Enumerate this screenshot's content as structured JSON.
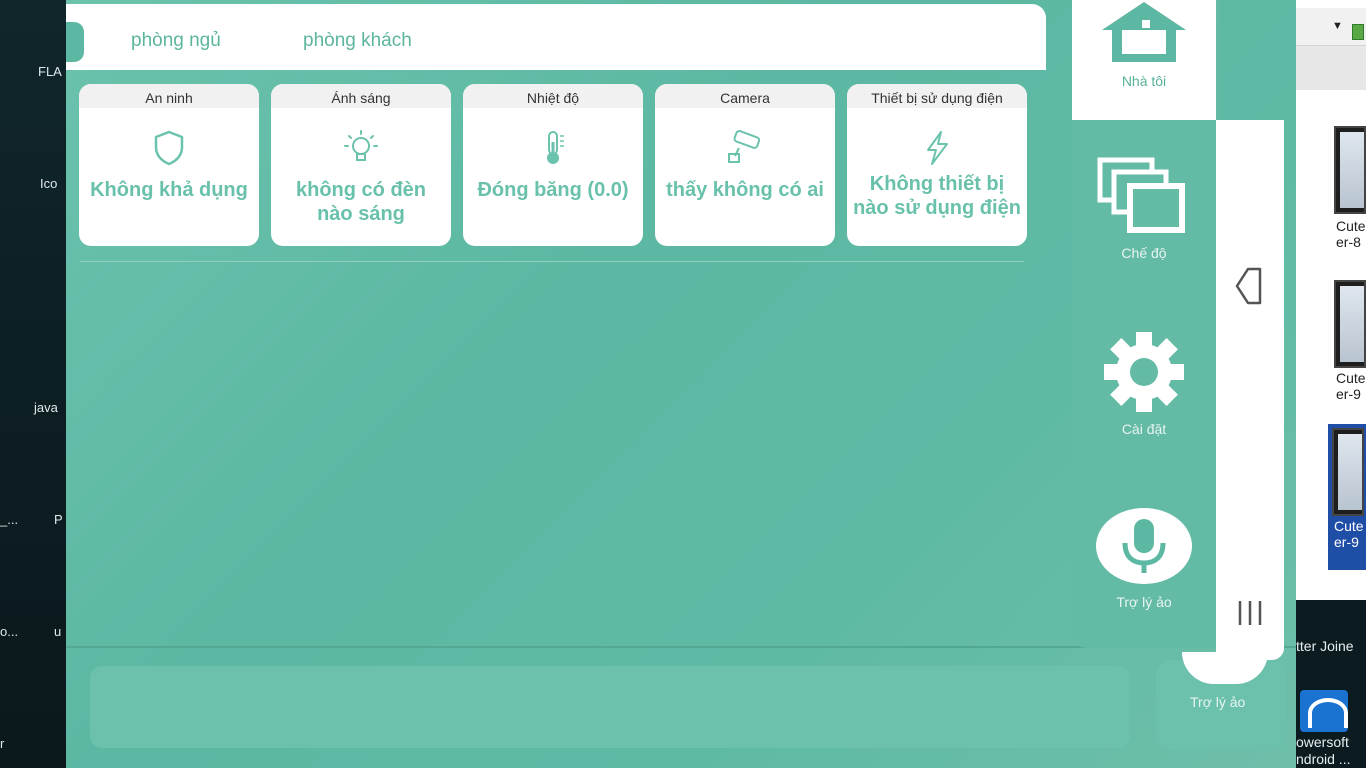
{
  "desktop": {
    "left_icons": [
      "FLA",
      "Ico",
      "java",
      "_...",
      "P",
      "o...",
      "u",
      "r"
    ],
    "explorer_thumbnails": [
      {
        "label_line1": "Cute",
        "label_line2": "er-8"
      },
      {
        "label_line1": "Cute",
        "label_line2": "er-9"
      },
      {
        "label_line1": "Cute",
        "label_line2": "er-9"
      }
    ],
    "taskbar_texts": [
      "tter Joine",
      "owersoft",
      "ndroid ..."
    ]
  },
  "tabs": [
    {
      "label": "phòng ngủ"
    },
    {
      "label": "phòng khách"
    }
  ],
  "cards": [
    {
      "title": "An ninh",
      "icon": "shield-icon",
      "status": "Không khả dụng"
    },
    {
      "title": "Ánh sáng",
      "icon": "lightbulb-icon",
      "status": "không có đèn nào sáng"
    },
    {
      "title": "Nhiệt độ",
      "icon": "thermometer-icon",
      "status": "Đóng băng (0.0)"
    },
    {
      "title": "Camera",
      "icon": "security-camera-icon",
      "status": "thấy không có ai"
    },
    {
      "title": "Thiết bị sử dụng điện",
      "icon": "lightning-icon",
      "status": "Không thiết bị nào sử dụng điện"
    }
  ],
  "sidebar": {
    "items": [
      {
        "label": "Nhà tôi",
        "icon": "home-icon",
        "active": true
      },
      {
        "label": "Chế độ",
        "icon": "layers-icon",
        "active": false
      },
      {
        "label": "Cài đặt",
        "icon": "gear-icon",
        "active": false
      },
      {
        "label": "Trợ lý ảo",
        "icon": "microphone-icon",
        "active": false
      }
    ]
  },
  "lower_ghost_label": "Trợ lý ảo",
  "colors": {
    "accent": "#5cb8a2",
    "accent_text": "#69c1ac",
    "card_bg": "#ffffff"
  }
}
